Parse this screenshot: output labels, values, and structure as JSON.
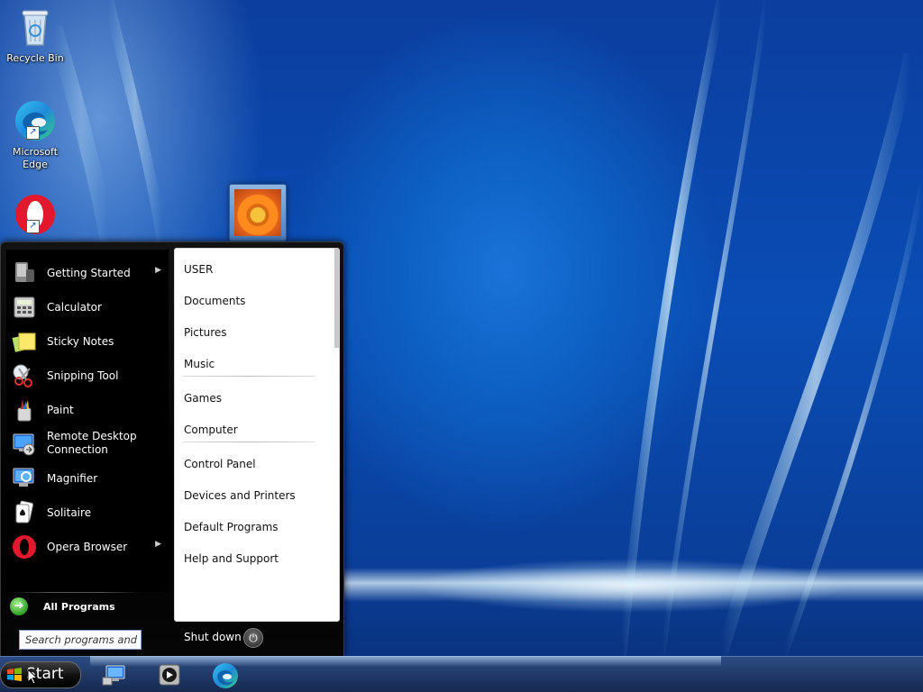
{
  "desktop": {
    "icons": [
      {
        "label": "Recycle Bin",
        "icon": "recycle-bin-icon"
      },
      {
        "label": "Microsoft Edge",
        "icon": "edge-icon"
      },
      {
        "label": "",
        "icon": "opera-icon"
      }
    ]
  },
  "start_menu": {
    "programs": [
      {
        "label": "Getting Started",
        "icon": "getting-started-icon",
        "has_submenu": true
      },
      {
        "label": "Calculator",
        "icon": "calculator-icon",
        "has_submenu": false
      },
      {
        "label": "Sticky Notes",
        "icon": "sticky-notes-icon",
        "has_submenu": false
      },
      {
        "label": "Snipping Tool",
        "icon": "snipping-tool-icon",
        "has_submenu": false
      },
      {
        "label": "Paint",
        "icon": "paint-icon",
        "has_submenu": false
      },
      {
        "label_line1": "Remote Desktop",
        "label_line2": "Connection",
        "icon": "remote-desktop-icon",
        "has_submenu": false
      },
      {
        "label": "Magnifier",
        "icon": "magnifier-icon",
        "has_submenu": false
      },
      {
        "label": "Solitaire",
        "icon": "solitaire-icon",
        "has_submenu": false
      },
      {
        "label": "Opera Browser",
        "icon": "opera-icon",
        "has_submenu": true
      }
    ],
    "all_programs_label": "All Programs",
    "search_placeholder": "Search programs and fi...",
    "places": [
      "USER",
      "Documents",
      "Pictures",
      "Music",
      "Games",
      "Computer",
      "Control Panel",
      "Devices and Printers",
      "Default Programs",
      "Help and Support"
    ],
    "shutdown_label": "Shut down"
  },
  "taskbar": {
    "start_label": "Start",
    "pinned": [
      "network-computer-icon",
      "media-player-icon",
      "edge-icon"
    ]
  },
  "colors": {
    "start_menu_bg": "#000000",
    "places_bg": "#ffffff",
    "taskbar_bg": "#213b6a",
    "wallpaper_blue": "#0a4db5"
  }
}
